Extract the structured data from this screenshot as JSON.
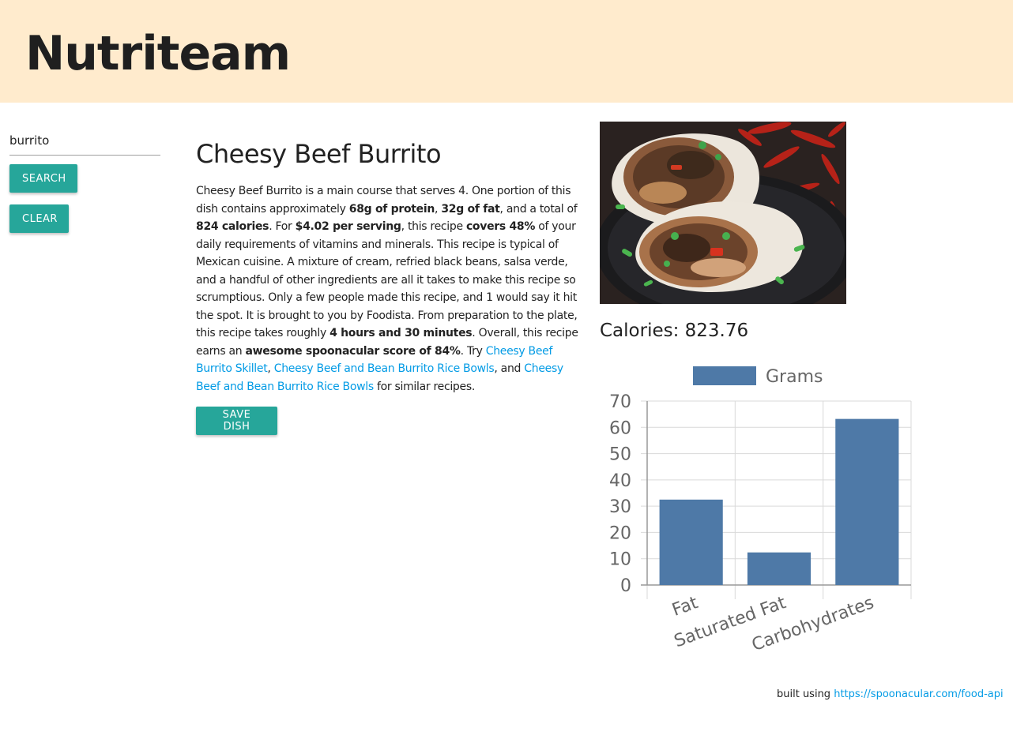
{
  "header": {
    "brand": "Nutriteam"
  },
  "search": {
    "value": "burrito",
    "search_label": "SEARCH",
    "clear_label": "CLEAR"
  },
  "recipe": {
    "title": "Cheesy Beef Burrito",
    "summary": {
      "s1": "Cheesy Beef Burrito is a main course that serves 4. One portion of this dish contains approximately ",
      "b1": "68g of protein",
      "s2": ", ",
      "b2": "32g of fat",
      "s3": ", and a total of ",
      "b3": "824 calories",
      "s4": ". For ",
      "b4": "$4.02 per serving",
      "s5": ", this recipe ",
      "b5": "covers 48%",
      "s6": " of your daily requirements of vitamins and minerals. This recipe is typical of Mexican cuisine. A mixture of cream, refried black beans, salsa verde, and a handful of other ingredients are all it takes to make this recipe so scrumptious. Only a few people made this recipe, and 1 would say it hit the spot. It is brought to you by Foodista. From preparation to the plate, this recipe takes roughly ",
      "b6": "4 hours and 30 minutes",
      "s7": ". Overall, this recipe earns an ",
      "b7": "awesome spoonacular score of 84%",
      "s8": ". Try ",
      "link1": "Cheesy Beef Burrito Skillet",
      "s9": ", ",
      "link2": "Cheesy Beef and Bean Burrito Rice Bowls",
      "s10": ", and ",
      "link3": "Cheesy Beef and Bean Burrito Rice Bowls",
      "s11": " for similar recipes."
    },
    "save_label": "SAVE DISH",
    "calories_label": "Calories: 823.76"
  },
  "chart_data": {
    "type": "bar",
    "categories": [
      "Fat",
      "Saturated Fat",
      "Carbohydrates"
    ],
    "series": [
      {
        "name": "Grams",
        "values": [
          32.5,
          12.4,
          63.2
        ]
      }
    ],
    "ylim": [
      0,
      70
    ],
    "yticks": [
      0,
      10,
      20,
      30,
      40,
      50,
      60,
      70
    ],
    "legend_position": "top",
    "grid": true,
    "bar_color": "#4e79a7"
  },
  "footer": {
    "prefix": "built using ",
    "link": "https://spoonacular.com/food-api"
  }
}
